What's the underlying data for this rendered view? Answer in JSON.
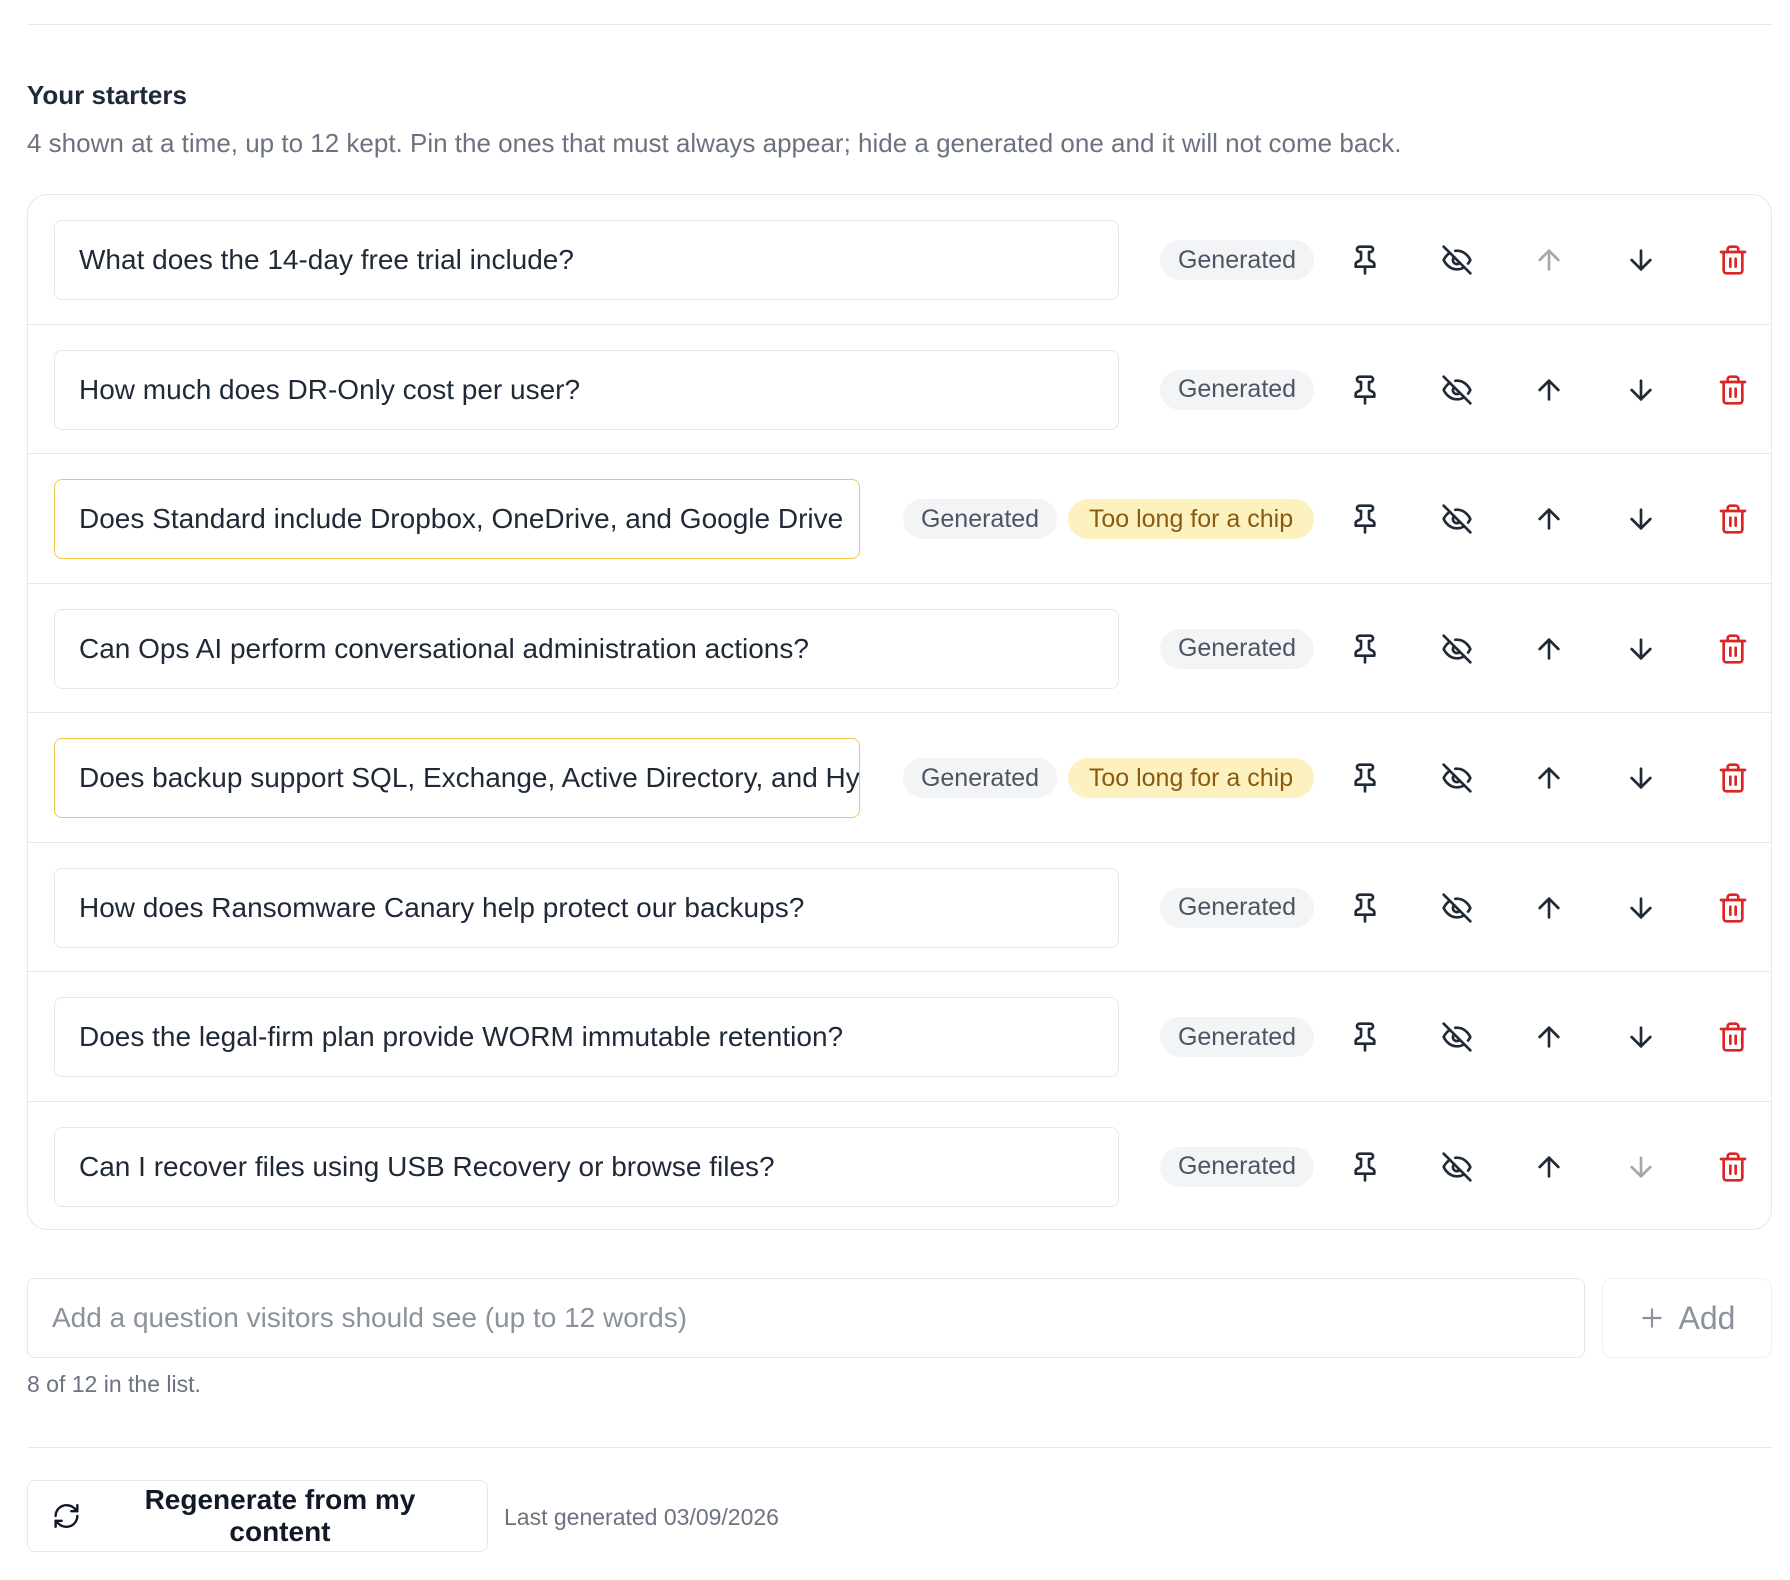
{
  "section": {
    "title": "Your starters",
    "description": "4 shown at a time, up to 12 kept. Pin the ones that must always appear; hide a generated one and it will not come back."
  },
  "starters": [
    {
      "text": "What does the 14-day free trial include?",
      "badge": "Generated",
      "warning": null,
      "up_enabled": false,
      "down_enabled": true
    },
    {
      "text": "How much does DR-Only cost per user?",
      "badge": "Generated",
      "warning": null,
      "up_enabled": true,
      "down_enabled": true
    },
    {
      "text": "Does Standard include Dropbox, OneDrive, and Google Drive",
      "badge": "Generated",
      "warning": "Too long for a chip",
      "up_enabled": true,
      "down_enabled": true
    },
    {
      "text": "Can Ops AI perform conversational administration actions?",
      "badge": "Generated",
      "warning": null,
      "up_enabled": true,
      "down_enabled": true
    },
    {
      "text": "Does backup support SQL, Exchange, Active Directory, and Hy",
      "badge": "Generated",
      "warning": "Too long for a chip",
      "up_enabled": true,
      "down_enabled": true
    },
    {
      "text": "How does Ransomware Canary help protect our backups?",
      "badge": "Generated",
      "warning": null,
      "up_enabled": true,
      "down_enabled": true
    },
    {
      "text": "Does the legal-firm plan provide WORM immutable retention?",
      "badge": "Generated",
      "warning": null,
      "up_enabled": true,
      "down_enabled": true
    },
    {
      "text": "Can I recover files using USB Recovery or browse files?",
      "badge": "Generated",
      "warning": null,
      "up_enabled": true,
      "down_enabled": false
    }
  ],
  "row_icons": [
    "pin-icon",
    "eye-off-icon",
    "arrow-up-icon",
    "arrow-down-icon",
    "trash-icon"
  ],
  "add": {
    "placeholder": "Add a question visitors should see (up to 12 words)",
    "value": "",
    "button_label": "Add",
    "button_icon": "plus-icon"
  },
  "count_note": "8 of 12 in the list.",
  "footer": {
    "regenerate_label": "Regenerate from my content",
    "regenerate_icon": "refresh-icon",
    "last_generated": "Last generated 03/09/2026"
  },
  "colors": {
    "warning_border": "#f2c84b",
    "warning_badge_bg": "#fdf1bf",
    "warning_badge_text": "#8a5a0f",
    "delete": "#dc2626",
    "badge_bg": "#f3f4f6"
  }
}
